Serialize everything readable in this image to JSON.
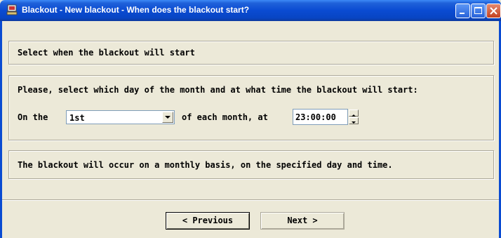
{
  "window": {
    "title": "Blackout - New blackout - When does the blackout start?"
  },
  "header": {
    "text": "Select when the blackout will start"
  },
  "schedule": {
    "prompt": "Please, select which day of the month and at what time the blackout will start:",
    "on_the_label": "On the",
    "day_selected": "1st",
    "each_month_label": "of each month, at",
    "time_value": "23:00:00"
  },
  "summary": {
    "text": "The blackout will occur on a monthly basis, on the specified day and time."
  },
  "buttons": {
    "previous_label": "< Previous",
    "next_label": "Next >"
  },
  "icons": {
    "app": "blackout-app-icon",
    "minimize": "minimize-icon",
    "maximize": "maximize-icon",
    "close": "close-icon",
    "dropdown": "chevron-down-icon",
    "spin_up": "spin-up-icon",
    "spin_down": "spin-down-icon"
  },
  "colors": {
    "titlebar": "#0a4bd2",
    "window_bg": "#ece9d8"
  }
}
